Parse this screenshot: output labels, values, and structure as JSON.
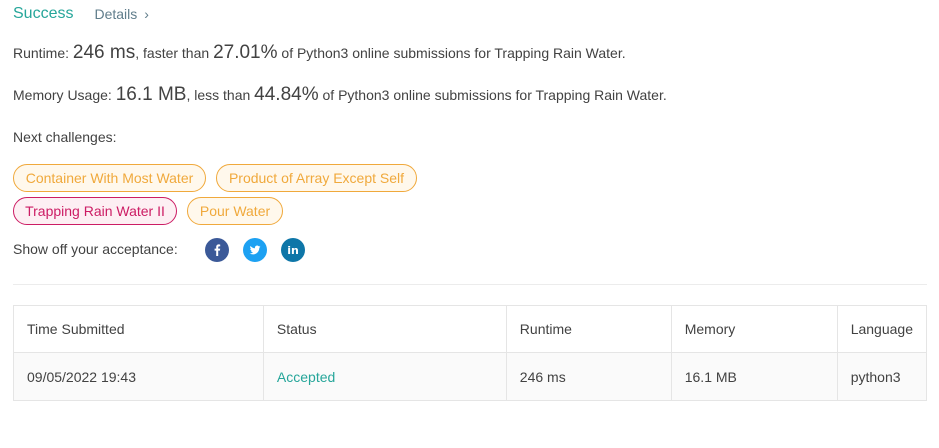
{
  "status": {
    "title": "Success",
    "details_label": "Details",
    "details_chevron": "›"
  },
  "runtime": {
    "label": "Runtime: ",
    "value": "246 ms",
    "comparison": ", faster than ",
    "percent": "27.01%",
    "suffix": " of Python3 online submissions for Trapping Rain Water."
  },
  "memory": {
    "label": "Memory Usage: ",
    "value": "16.1 MB",
    "comparison": ", less than ",
    "percent": "44.84%",
    "suffix": " of Python3 online submissions for Trapping Rain Water."
  },
  "next_challenges": {
    "label": "Next challenges:",
    "items": [
      {
        "label": "Container With Most Water",
        "difficulty": "medium"
      },
      {
        "label": "Product of Array Except Self",
        "difficulty": "medium"
      },
      {
        "label": "Trapping Rain Water II",
        "difficulty": "hard"
      },
      {
        "label": "Pour Water",
        "difficulty": "medium"
      }
    ]
  },
  "share": {
    "label": "Show off your acceptance:",
    "icons": [
      "facebook-icon",
      "twitter-icon",
      "linkedin-icon"
    ]
  },
  "submissions_table": {
    "headers": [
      "Time Submitted",
      "Status",
      "Runtime",
      "Memory",
      "Language"
    ],
    "rows": [
      [
        "09/05/2022 19:43",
        "Accepted",
        "246 ms",
        "16.1 MB",
        "python3"
      ]
    ]
  },
  "colors": {
    "accent_green": "#26a69a",
    "medium_orange": "#f0a93c",
    "hard_pink": "#cc1c64",
    "facebook_blue": "#3b5998",
    "twitter_blue": "#1da1f2",
    "linkedin_blue": "#0e76a8"
  }
}
